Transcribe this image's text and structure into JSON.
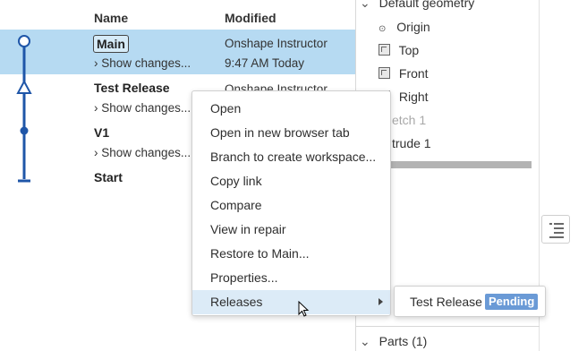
{
  "columns": {
    "name": "Name",
    "modified": "Modified"
  },
  "versions": [
    {
      "name": "Main",
      "changes": "Show changes...",
      "author": "Onshape Instructor",
      "date": "9:47 AM Today"
    },
    {
      "name": "Test Release",
      "changes": "Show changes...",
      "author": "Onshape Instructor"
    },
    {
      "name": "V1",
      "changes": "Show changes..."
    },
    {
      "name": "Start"
    }
  ],
  "tree": {
    "section_title": "Default geometry",
    "items": [
      "Origin",
      "Top",
      "Front",
      "Right",
      "etch 1",
      "trude 1"
    ],
    "parts_label": "Parts (1)"
  },
  "context_menu": {
    "items": [
      "Open",
      "Open in new browser tab",
      "Branch to create workspace...",
      "Copy link",
      "Compare",
      "View in repair",
      "Restore to Main...",
      "Properties...",
      "Releases"
    ]
  },
  "submenu": {
    "label": "Test Release",
    "badge": "Pending"
  },
  "colors": {
    "selection": "#b6daf2",
    "graph": "#1f56a8",
    "badge": "#6a9ad6",
    "menu_hover": "#dcebf7"
  },
  "icons": [
    "branch-graph-icon",
    "chevron-right-icon",
    "chevron-down-icon",
    "origin-icon",
    "plane-icon",
    "list-icon",
    "submenu-arrow-icon",
    "mouse-pointer-icon"
  ]
}
